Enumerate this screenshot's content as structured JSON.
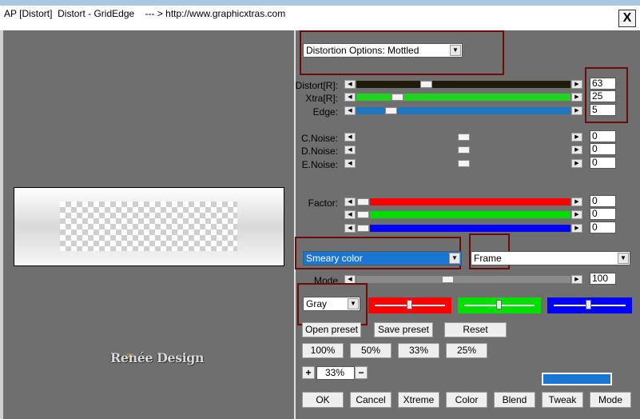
{
  "window": {
    "title": "AP [Distort]  Distort - GridEdge    --- > http://www.graphicxtras.com",
    "close_label": "X"
  },
  "logo": {
    "text": "Renée Design"
  },
  "distortion_dropdown": {
    "value": "Distortion Options: Mottled"
  },
  "sliders": {
    "distort": {
      "label": "Distort[R]:",
      "value": "63",
      "color": "#1e1a0c"
    },
    "xtra": {
      "label": "Xtra[R]:",
      "value": "25",
      "color": "#1fd31f"
    },
    "edge": {
      "label": "Edge:",
      "value": "5",
      "color": "#1f77c0"
    },
    "cnoise": {
      "label": "C.Noise:",
      "value": "0"
    },
    "dnoise": {
      "label": "D.Noise:",
      "value": "0"
    },
    "enoise": {
      "label": "E.Noise:",
      "value": "0"
    },
    "factor_r": {
      "label": "Factor:",
      "value": "0",
      "color": "#ff0000"
    },
    "factor_g": {
      "value": "0",
      "color": "#00e000"
    },
    "factor_b": {
      "value": "0",
      "color": "#0000ff"
    },
    "mode": {
      "label": "Mode",
      "value": "100"
    }
  },
  "selects": {
    "smeary": {
      "value": "Smeary color"
    },
    "frame": {
      "value": "Frame"
    },
    "gray": {
      "value": "Gray"
    }
  },
  "buttons": {
    "open_preset": "Open preset",
    "save_preset": "Save preset",
    "reset": "Reset",
    "zoom100": "100%",
    "zoom50": "50%",
    "zoom33": "33%",
    "zoom25": "25%",
    "zoom_plus": "+",
    "zoom_value": "33%",
    "zoom_minus": "−",
    "ok": "OK",
    "cancel": "Cancel",
    "xtreme": "Xtreme",
    "color": "Color",
    "blend": "Blend",
    "tweak": "Tweak",
    "mode": "Mode"
  },
  "swatch_color": "#1976d2"
}
